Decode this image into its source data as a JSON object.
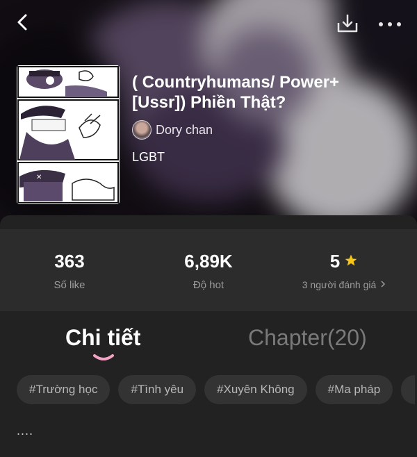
{
  "story": {
    "title": "( Countryhumans/ Power+[Ussr]) Phiền Thật?",
    "author": "Dory chan",
    "genre": "LGBT"
  },
  "stats": {
    "likes_value": "363",
    "likes_label": "Số like",
    "hot_value": "6,89K",
    "hot_label": "Độ hot",
    "rating_value": "5",
    "rating_label": "3 người đánh giá"
  },
  "tabs": {
    "detail": "Chi tiết",
    "chapter": "Chapter(20)"
  },
  "tags": [
    "#Trường học",
    "#Tình yêu",
    "#Xuyên Không",
    "#Ma pháp"
  ],
  "description": "....",
  "icons": {
    "back": "back-arrow-icon",
    "download": "download-icon",
    "more": "more-dots-icon",
    "rating": "star-icon",
    "rating_more": "chevron-right-icon"
  },
  "colors": {
    "accent": "#f2a3c4",
    "star": "#f5c518",
    "panel": "#222222",
    "card": "#2c2c2c"
  }
}
